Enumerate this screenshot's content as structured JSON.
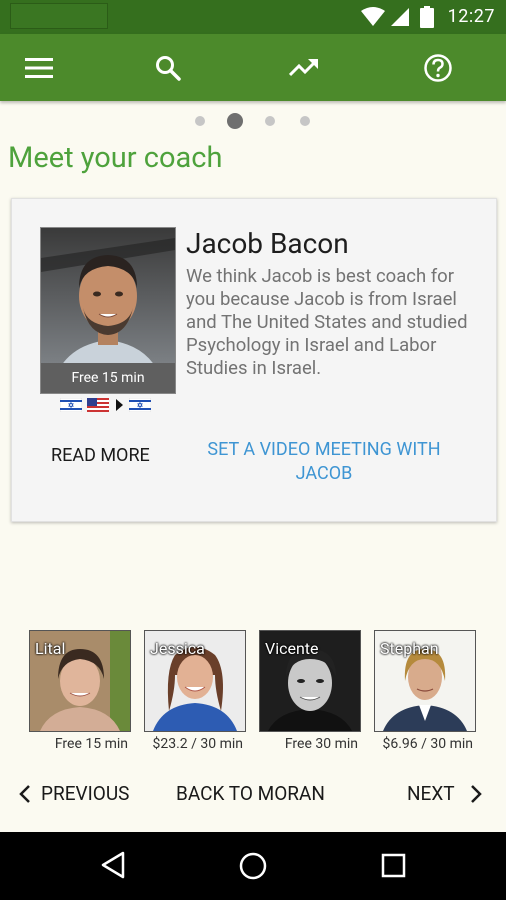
{
  "status_bar": {
    "time": "12:27"
  },
  "toolbar": {
    "icons": [
      "menu-icon",
      "search-icon",
      "trending-up-icon",
      "help-icon"
    ]
  },
  "pager": {
    "count": 4,
    "active_index": 1
  },
  "page": {
    "title": "Meet your coach"
  },
  "coach": {
    "name": "Jacob Bacon",
    "description": "We think Jacob is best coach for you because Jacob is from Israel and The United States and studied Psychology in Israel and Labor Studies in Israel.",
    "photo_badge": "Free 15 min",
    "flags": [
      "israel-flag",
      "usa-flag",
      "arrow-right-icon",
      "israel-flag"
    ],
    "read_more_label": "READ MORE",
    "set_meeting_label": "SET A VIDEO MEETING WITH JACOB"
  },
  "other_coaches": [
    {
      "name": "Lital",
      "price": "Free 15 min"
    },
    {
      "name": "Jessica",
      "price": "$23.2 / 30 min"
    },
    {
      "name": "Vicente",
      "price": "Free 30 min"
    },
    {
      "name": "Stephan",
      "price": "$6.96 / 30 min"
    }
  ],
  "bottom_nav": {
    "previous_label": "PREVIOUS",
    "back_label": "BACK TO MORAN",
    "next_label": "NEXT"
  },
  "colors": {
    "toolbar": "#4c8a2b",
    "status_bar": "#356f1e",
    "title": "#4ea23c",
    "link": "#3e95d3"
  }
}
